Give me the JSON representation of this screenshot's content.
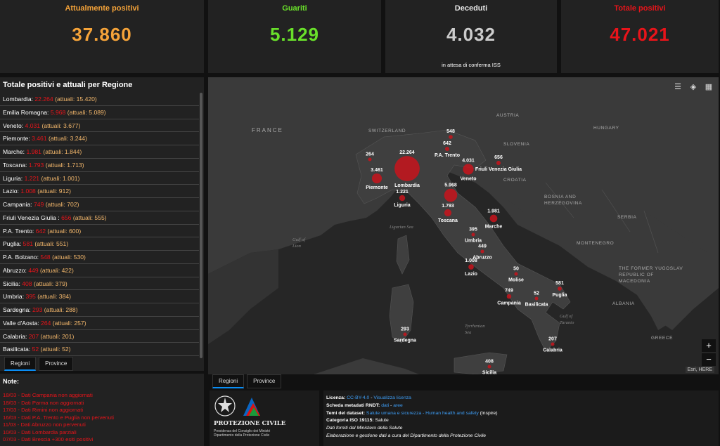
{
  "kpis": [
    {
      "title": "Attualmente positivi",
      "value": "37.860",
      "sub": "",
      "color": "#f5a339"
    },
    {
      "title": "Guariti",
      "value": "5.129",
      "sub": "",
      "color": "#69e02a"
    },
    {
      "title": "Deceduti",
      "value": "4.032",
      "sub": "in attesa di conferma ISS",
      "color": "#cccccc"
    },
    {
      "title": "Totale positivi",
      "value": "47.021",
      "sub": "",
      "color": "#e8141a"
    }
  ],
  "regions_panel": {
    "title": "Totale positivi e attuali per Regione",
    "rows": [
      {
        "name": "Lombardia:",
        "total": "22.264",
        "current": "(attuali: 15.420)"
      },
      {
        "name": "Emilia Romagna:",
        "total": "5.968",
        "current": "(attuali: 5.089)"
      },
      {
        "name": "Veneto:",
        "total": "4.031",
        "current": "(attuali: 3.677)"
      },
      {
        "name": "Piemonte:",
        "total": "3.461",
        "current": "(attuali: 3.244)"
      },
      {
        "name": "Marche:",
        "total": "1.981",
        "current": "(attuali: 1.844)"
      },
      {
        "name": "Toscana:",
        "total": "1.793",
        "current": "(attuali: 1.713)"
      },
      {
        "name": "Liguria:",
        "total": "1.221",
        "current": "(attuali: 1.001)"
      },
      {
        "name": "Lazio:",
        "total": "1.008",
        "current": "(attuali: 912)"
      },
      {
        "name": "Campania:",
        "total": "749",
        "current": "(attuali: 702)"
      },
      {
        "name": "Friuli Venezia Giulia :",
        "total": "656",
        "current": "(attuali: 555)"
      },
      {
        "name": "P.A. Trento:",
        "total": "642",
        "current": "(attuali: 600)"
      },
      {
        "name": "Puglia:",
        "total": "581",
        "current": "(attuali: 551)"
      },
      {
        "name": "P.A. Bolzano:",
        "total": "548",
        "current": "(attuali: 530)"
      },
      {
        "name": "Abruzzo:",
        "total": "449",
        "current": "(attuali: 422)"
      },
      {
        "name": "Sicilia:",
        "total": "408",
        "current": "(attuali: 379)"
      },
      {
        "name": "Umbria:",
        "total": "395",
        "current": "(attuali: 384)"
      },
      {
        "name": "Sardegna:",
        "total": "293",
        "current": "(attuali: 288)"
      },
      {
        "name": "Valle d'Aosta:",
        "total": "264",
        "current": "(attuali: 257)"
      },
      {
        "name": "Calabria:",
        "total": "207",
        "current": "(attuali: 201)"
      },
      {
        "name": "Basilicata:",
        "total": "52",
        "current": "(attuali: 52)"
      }
    ],
    "tabs": [
      "Regioni",
      "Province"
    ]
  },
  "notes": {
    "title": "Note:",
    "items": [
      "18/03 - Dati Campania non aggiornati",
      "18/03 - Dati Parma non aggiornati",
      "17/03 - Dati Rimini non aggiornati",
      "16/03 - Dati P.A. Trento e Puglia non pervenuti",
      "11/03 - Dati Abruzzo non pervenuti",
      "10/03 - Dati Lombardia parziali",
      "07/03 - Dati Brescia +300 esiti positivi"
    ]
  },
  "map": {
    "countries": [
      "FRANCE",
      "SWITZERLAND",
      "AUSTRIA",
      "HUNGARY",
      "SLOVENIA",
      "CROATIA",
      "BOSNIA AND HERZEGOVINA",
      "SERBIA",
      "MONTENEGRO",
      "ALBANIA",
      "THE FORMER YUGOSLAV REPUBLIC OF MACEDONIA",
      "GREECE"
    ],
    "seas": [
      "Gulf of Lion",
      "Ligurian Sea",
      "Tyrrhenian Sea",
      "Gulf of Taranto"
    ],
    "markers": [
      {
        "value": "22.264",
        "region": "Lombardia",
        "count": 22264
      },
      {
        "value": "5.968",
        "region": "",
        "count": 5968
      },
      {
        "value": "4.031",
        "region": "Veneto",
        "count": 4031
      },
      {
        "value": "3.461",
        "region": "Piemonte",
        "count": 3461
      },
      {
        "value": "1.981",
        "region": "Marche",
        "count": 1981
      },
      {
        "value": "1.793",
        "region": "Toscana",
        "count": 1793
      },
      {
        "value": "1.221",
        "region": "Liguria",
        "count": 1221
      },
      {
        "value": "1.008",
        "region": "Lazio",
        "count": 1008
      },
      {
        "value": "749",
        "region": "Campania",
        "count": 749
      },
      {
        "value": "656",
        "region": "Friuli Venezia Giulia",
        "count": 656
      },
      {
        "value": "642",
        "region": "P.A. Trento",
        "count": 642
      },
      {
        "value": "581",
        "region": "Puglia",
        "count": 581
      },
      {
        "value": "548",
        "region": "",
        "count": 548
      },
      {
        "value": "449",
        "region": "Abruzzo",
        "count": 449
      },
      {
        "value": "408",
        "region": "Sicilia",
        "count": 408
      },
      {
        "value": "395",
        "region": "Umbria",
        "count": 395
      },
      {
        "value": "293",
        "region": "Sardegna",
        "count": 293
      },
      {
        "value": "264",
        "region": "",
        "count": 264
      },
      {
        "value": "207",
        "region": "Calabria",
        "count": 207
      },
      {
        "value": "52",
        "region": "Basilicata",
        "count": 52
      },
      {
        "value": "50",
        "region": "Molise",
        "count": 50
      }
    ],
    "attribution": "Esri, HERE",
    "zoom_in": "+",
    "zoom_out": "−",
    "tabs": [
      "Regioni",
      "Province"
    ],
    "marker_color": "#c8141c"
  },
  "logo": {
    "title": "PROTEZIONE CIVILE",
    "line1": "Presidenza del Consiglio dei Ministri",
    "line2": "Dipartimento della Protezione Civile"
  },
  "info": {
    "license_label": "Licenza:",
    "license_link": "CC-BY-4.0",
    "license_sep": " - ",
    "license_view": "Visualizza licenza",
    "meta_label": "Scheda metadati RNDT:",
    "meta_dati": "dati",
    "meta_sep": " - ",
    "meta_aree": "aree",
    "themes_label": "Temi del dataset:",
    "themes_link": "Salute umana e sicurezza - Human health and safety",
    "themes_suffix": " (Inspire)",
    "iso_label": "Categoria ISO 19115:",
    "iso_value": " Salute",
    "line5": "Dati forniti dal Ministero della Salute",
    "line6": "Elaborazione e gestione dati a cura del Dipartimento della Protezione Civile"
  }
}
